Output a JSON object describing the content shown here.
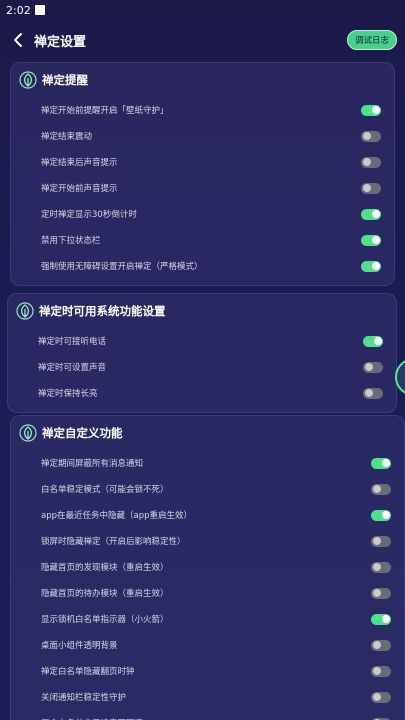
{
  "status": {
    "time": "2:02"
  },
  "header": {
    "title": "禅定设置",
    "debug_label": "调试日志"
  },
  "sections": [
    {
      "title": "禅定提醒",
      "items": [
        {
          "label": "禅定开始前提醒开启「壁纸守护」",
          "on": true
        },
        {
          "label": "禅定结束震动",
          "on": false
        },
        {
          "label": "禅定结束后声音提示",
          "on": false
        },
        {
          "label": "禅定开始前声音提示",
          "on": false
        },
        {
          "label": "定时禅定显示30秒倒计时",
          "on": true
        },
        {
          "label": "禁用下拉状态栏",
          "on": true
        },
        {
          "label": "强制使用无障碍设置开启禅定（严格模式）",
          "on": true
        }
      ]
    },
    {
      "title": "禅定时可用系统功能设置",
      "items": [
        {
          "label": "禅定时可接听电话",
          "on": true
        },
        {
          "label": "禅定时可设置声音",
          "on": false
        },
        {
          "label": "禅定时保持长亮",
          "on": false
        }
      ]
    },
    {
      "title": "禅定自定义功能",
      "items": [
        {
          "label": "禅定期间屏蔽所有消息通知",
          "on": true
        },
        {
          "label": "白名单稳定模式（可能会锁不死）",
          "on": false
        },
        {
          "label": "app在最近任务中隐藏（app重启生效）",
          "on": true
        },
        {
          "label": "锁屏时隐藏禅定（开启后影响稳定性）",
          "on": false
        },
        {
          "label": "隐藏首页的发现模块（重启生效）",
          "on": false
        },
        {
          "label": "隐藏首页的待办模块（重启生效）",
          "on": false
        },
        {
          "label": "显示锁机白名单指示器（小火箭）",
          "on": true
        },
        {
          "label": "桌面小组件透明背景",
          "on": false
        },
        {
          "label": "禅定白名单隐藏翻页时钟",
          "on": false
        },
        {
          "label": "关闭通知栏稳定性守护",
          "on": false
        },
        {
          "label": "混合白名单应用设定可回滚",
          "on": false
        }
      ]
    }
  ],
  "colors": {
    "toggle_on": "#4fe08e",
    "toggle_off": "#6a6b78",
    "accent": "#49d08b"
  },
  "icons": {
    "back": "chevron-left-icon",
    "section": "leaf-icon"
  }
}
